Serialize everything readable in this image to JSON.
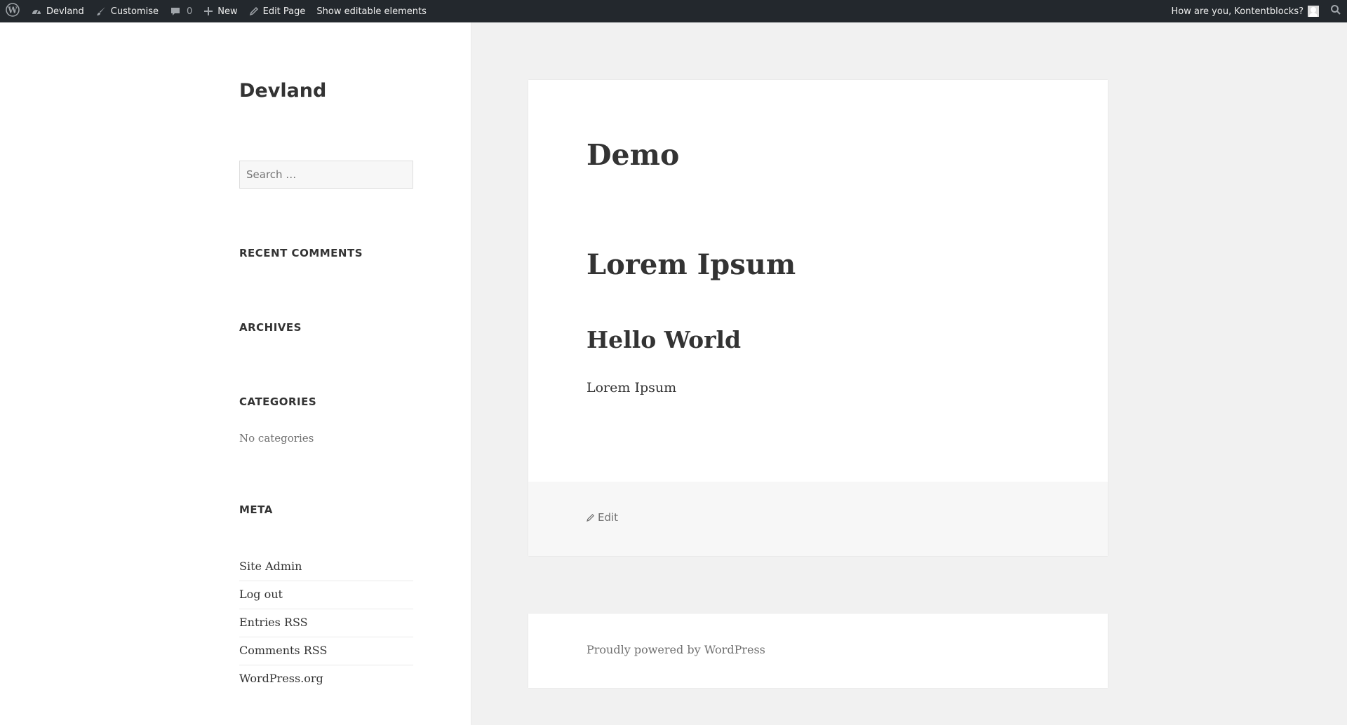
{
  "admin_bar": {
    "wp_logo_icon": "wordpress-logo-icon",
    "site_name": "Devland",
    "customise": "Customise",
    "comments_count": "0",
    "new": "New",
    "edit_page": "Edit Page",
    "show_editable": "Show editable elements",
    "greeting": "How are you, Kontentblocks?"
  },
  "sidebar": {
    "site_title": "Devland",
    "search_placeholder": "Search …",
    "recent_comments_title": "RECENT COMMENTS",
    "archives_title": "ARCHIVES",
    "categories_title": "CATEGORIES",
    "no_categories": "No categories",
    "meta_title": "META",
    "meta_links": [
      "Site Admin",
      "Log out",
      "Entries RSS",
      "Comments RSS",
      "WordPress.org"
    ]
  },
  "article": {
    "title": "Demo",
    "heading1": "Lorem Ipsum",
    "heading2": "Hello World",
    "paragraph": "Lorem Ipsum",
    "edit_label": "Edit"
  },
  "footer": {
    "powered_by": "Proudly powered by WordPress"
  }
}
